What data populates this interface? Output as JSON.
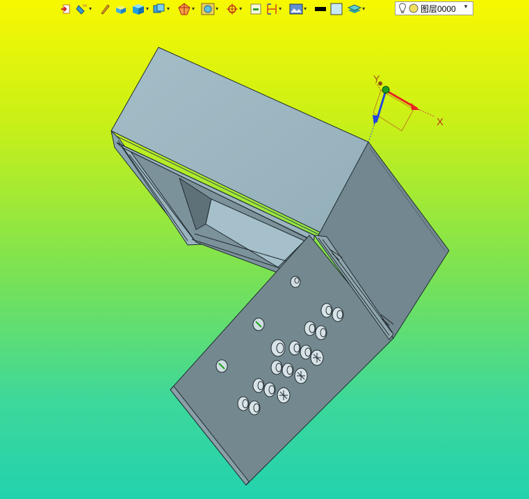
{
  "toolbar": {
    "layer_name": "图层0000",
    "buttons": [
      "exit-sketch-icon",
      "paint-bucket-icon",
      "pen-icon",
      "box-icon",
      "solid-view-icon",
      "view-cube-icon",
      "section-icon",
      "render-icon",
      "snap-icon",
      "frame-icon",
      "dimension-icon",
      "image-icon",
      "line-color-icon",
      "fill-color-icon",
      "layer-stack-icon"
    ]
  },
  "axis": {
    "x_label": "X",
    "y_label": "Y"
  },
  "colors": {
    "background_top": "#f8f800",
    "background_bottom": "#22d2ae",
    "model_light": "#9ab4bf",
    "model_mid": "#8aa5b1",
    "model_dark": "#72878f",
    "edge": "#1f2a2f",
    "axis_x": "#e82222",
    "axis_y": "#1fa11f",
    "axis_z": "#2244e0"
  }
}
